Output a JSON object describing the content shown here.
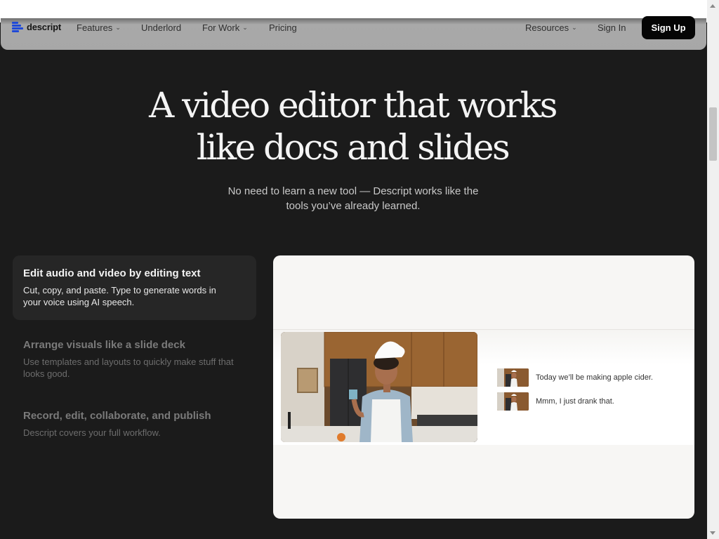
{
  "brand": {
    "name": "descript",
    "accent": "#1f49d8"
  },
  "nav": {
    "items": [
      {
        "label": "Features",
        "has_dropdown": true
      },
      {
        "label": "Underlord",
        "has_dropdown": false
      },
      {
        "label": "For Work",
        "has_dropdown": true
      },
      {
        "label": "Pricing",
        "has_dropdown": false
      },
      {
        "label": "Resources",
        "has_dropdown": true
      },
      {
        "label": "Sign In",
        "has_dropdown": false
      }
    ],
    "signup_label": "Sign Up",
    "dropdown_icon": "chevron-down-icon"
  },
  "hero": {
    "title_line1": "A video editor that works",
    "title_line2": "like docs and slides",
    "subtitle_line1": "No need to learn a new tool — Descript works like the",
    "subtitle_line2": "tools you’ve already learned."
  },
  "features": [
    {
      "title": "Edit audio and video by editing text",
      "description": "Cut, copy, and paste. Type to generate words in your voice using AI speech.",
      "active": true
    },
    {
      "title": "Arrange visuals like a slide deck",
      "description": "Use templates and layouts to quickly make stuff that looks good.",
      "active": false
    },
    {
      "title": "Record, edit, collaborate, and publish",
      "description": "Descript covers your full workflow.",
      "active": false
    }
  ],
  "preview": {
    "transcript": [
      {
        "text": "Today we’ll be making apple cider."
      },
      {
        "text": "Mmm, I just drank that."
      }
    ]
  }
}
